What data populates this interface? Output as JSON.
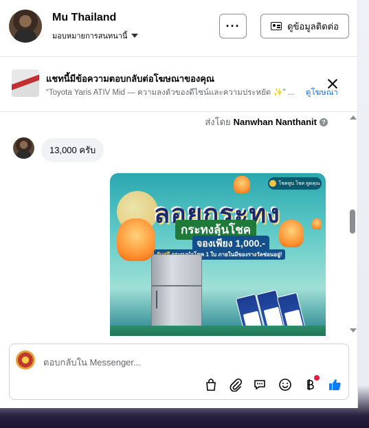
{
  "header": {
    "page_name": "Mu Thailand",
    "assign_label": "มอบหมายการสนทนานี้",
    "more_label": "···",
    "contact_label": "ดูข้อมูลติดต่อ"
  },
  "ad_banner": {
    "title": "แชทนี้มีข้อความตอบกลับต่อโฆษณาของคุณ",
    "subtitle": "“Toyota Yaris ATIV Mid — ความลงตัวของดีไซน์และความประหยัด ✨” ...",
    "link": "ดูโฆษณา"
  },
  "thread": {
    "sent_by_prefix": "ส่งโดย",
    "sent_by_name": "Nanwhan Nanthanit",
    "info_mark": "?",
    "message": "13,000 ครับ",
    "poster": {
      "headline": "ลอยกระทง",
      "line1": "กระทงลุ้นโชค",
      "line2": "จองเพียง 1,000.-",
      "line3_highlight": "รับฟรี",
      "line3": " กระทงนำโชค 1 ใบ ภายในมีของรางวัลซ่อนอยู่!",
      "logo_text": "โชคทูน โชค ทูดคุณ"
    }
  },
  "composer": {
    "placeholder": "ตอบกลับใน Messenger..."
  },
  "colors": {
    "accent_blue": "#1b74e4",
    "like_blue": "#0a7cff",
    "notification_red": "#e41e3f"
  },
  "icons": [
    "more-icon",
    "id-card-icon",
    "close-icon",
    "info-icon",
    "bag-icon",
    "paperclip-icon",
    "chat-bubbles-icon",
    "smiley-icon",
    "baht-icon",
    "thumbs-up-icon"
  ]
}
